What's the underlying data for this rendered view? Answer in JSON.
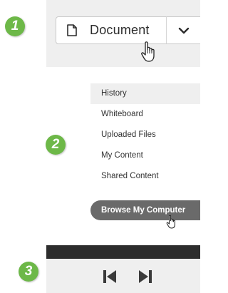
{
  "steps": {
    "one": "1",
    "two": "2",
    "three": "3"
  },
  "document_dropdown": {
    "label": "Document",
    "icon": "document-icon",
    "menu_icon": "chevron-down-icon"
  },
  "menu": {
    "items": [
      {
        "label": "History",
        "active": true
      },
      {
        "label": "Whiteboard",
        "active": false
      },
      {
        "label": "Uploaded Files",
        "active": false
      },
      {
        "label": "My Content",
        "active": false
      },
      {
        "label": "Shared Content",
        "active": false
      }
    ],
    "browse_button": "Browse My Computer"
  },
  "playback": {
    "prev_icon": "skip-previous-icon",
    "next_icon": "skip-next-icon"
  },
  "colors": {
    "badge": "#6db848",
    "panel": "#efefef",
    "browse_button": "#6a6a6a",
    "dark_bar": "#2d2d2d"
  }
}
